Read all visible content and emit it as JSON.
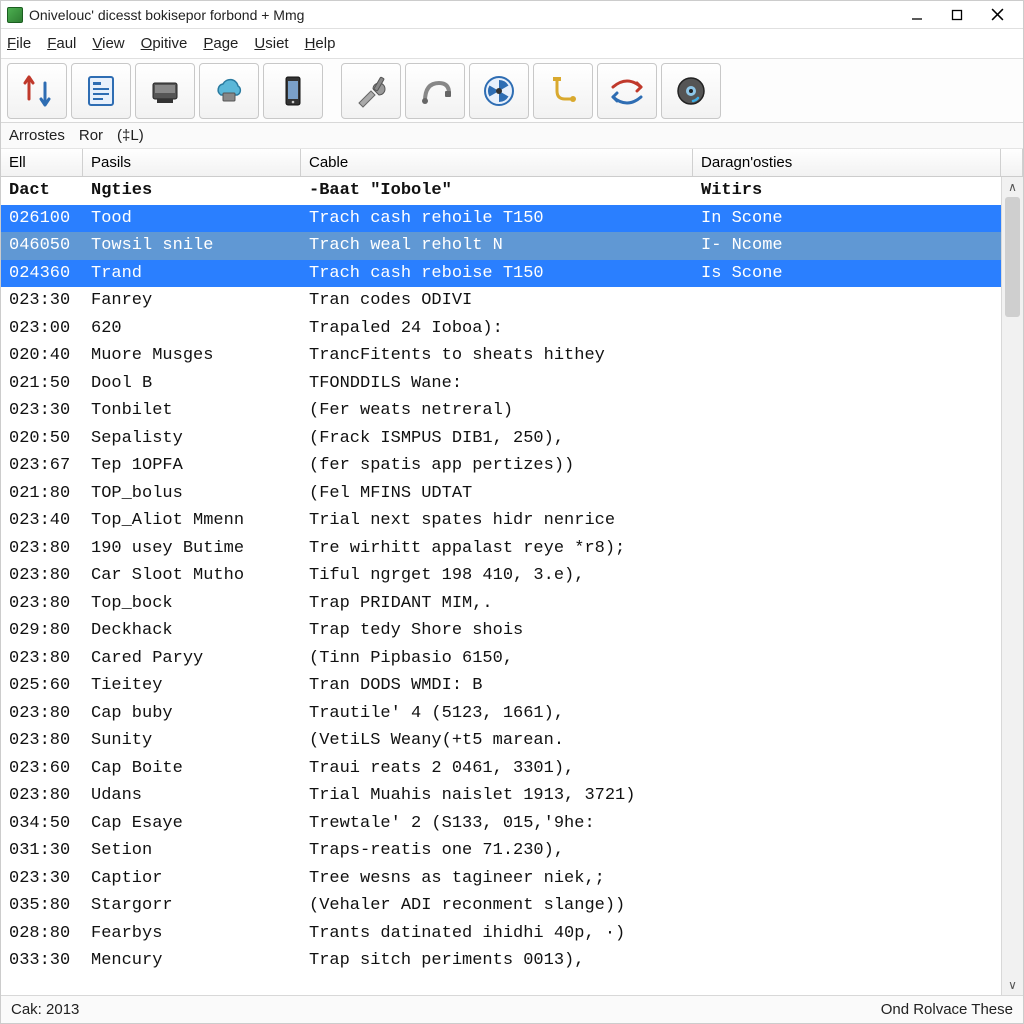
{
  "window": {
    "title": "Onivelouc' dicesst bokisepor forbond + Mmg"
  },
  "menu": {
    "items": [
      {
        "label_pre": "",
        "ul": "F",
        "label_post": "ile"
      },
      {
        "label_pre": "",
        "ul": "F",
        "label_post": "aul"
      },
      {
        "label_pre": "",
        "ul": "V",
        "label_post": "iew"
      },
      {
        "label_pre": "",
        "ul": "O",
        "label_post": "pitive"
      },
      {
        "label_pre": "",
        "ul": "P",
        "label_post": "age"
      },
      {
        "label_pre": "",
        "ul": "U",
        "label_post": "siet"
      },
      {
        "label_pre": "",
        "ul": "H",
        "label_post": "elp"
      }
    ]
  },
  "subbar": {
    "a": "Arrostes",
    "b": "Ror",
    "c": "(‡L)"
  },
  "headers": {
    "a": "Ell",
    "b": "Pasils",
    "c": "Cable",
    "d": "Daragn'osties"
  },
  "rows": [
    {
      "state": "header",
      "a": "Dact",
      "b": "Ngties",
      "c": "-Baat \"Iobole\"",
      "d": "Witirs"
    },
    {
      "state": "sel",
      "a": "026100",
      "b": "Tood",
      "c": "Trach cash rehoile T150",
      "d": "In Scone"
    },
    {
      "state": "seldim",
      "a": "046050",
      "b": "Towsil snile",
      "c": "Trach weal reholt N",
      "d": "I- Ncome"
    },
    {
      "state": "sel",
      "a": "024360",
      "b": "Trand",
      "c": "Trach cash reboise T150",
      "d": "Is Scone"
    },
    {
      "state": "",
      "a": "023:30",
      "b": "Fanrey",
      "c": "Tran codes ODIVI",
      "d": ""
    },
    {
      "state": "",
      "a": "023:00",
      "b": "620",
      "c": "Trapaled 24 Ioboa):",
      "d": ""
    },
    {
      "state": "",
      "a": "020:40",
      "b": "Muore Musges",
      "c": "TrancFitents to sheats hithey",
      "d": ""
    },
    {
      "state": "",
      "a": "021:50",
      "b": "Dool B",
      "c": "TFONDDILS Wane:",
      "d": ""
    },
    {
      "state": "",
      "a": "023:30",
      "b": "Tonbilet",
      "c": "(Fer weats netreral)",
      "d": ""
    },
    {
      "state": "",
      "a": "020:50",
      "b": "Sepalisty",
      "c": "(Frack ISMPUS DIB1, 250),",
      "d": ""
    },
    {
      "state": "",
      "a": "023:67",
      "b": "Tep 1OPFA",
      "c": "(fer spatis app pertizes))",
      "d": ""
    },
    {
      "state": "",
      "a": "021:80",
      "b": "TOP_bolus",
      "c": "(Fel MFINS UDTAT",
      "d": ""
    },
    {
      "state": "",
      "a": "023:40",
      "b": "Top_Aliot Mmenn",
      "c": "Trial next spates hidr nenrice",
      "d": ""
    },
    {
      "state": "",
      "a": "023:80",
      "b": "190 usey Butime",
      "c": "Tre wirhitt appalast reye *r8);",
      "d": ""
    },
    {
      "state": "",
      "a": "023:80",
      "b": "Car Sloot Mutho",
      "c": "Tiful ngrget 198 410, 3.e),",
      "d": ""
    },
    {
      "state": "",
      "a": "023:80",
      "b": "Top_bock",
      "c": "Trap PRIDANT MIM,.",
      "d": ""
    },
    {
      "state": "",
      "a": "029:80",
      "b": "Deckhack",
      "c": "Trap tedy Shore shois",
      "d": ""
    },
    {
      "state": "",
      "a": "023:80",
      "b": "Cared Paryy",
      "c": "(Tinn Pipbasio 6150,",
      "d": ""
    },
    {
      "state": "",
      "a": "025:60",
      "b": "Tieitey",
      "c": "Tran DODS WMDI: B",
      "d": ""
    },
    {
      "state": "",
      "a": "023:80",
      "b": "Cap buby",
      "c": "Trautile' 4 (5123, 1661),",
      "d": ""
    },
    {
      "state": "",
      "a": "023:80",
      "b": "Sunity",
      "c": "(VetiLS Weany(+t5 marean.",
      "d": ""
    },
    {
      "state": "",
      "a": "023:60",
      "b": "Cap Boite",
      "c": "Traui reats 2 0461, 3301),",
      "d": ""
    },
    {
      "state": "",
      "a": "023:80",
      "b": "Udans",
      "c": "Trial Muahis naislet 1913, 3721)",
      "d": ""
    },
    {
      "state": "",
      "a": "034:50",
      "b": "Cap Esaye",
      "c": "Trewtale' 2 (S133, 015,'9he:",
      "d": ""
    },
    {
      "state": "",
      "a": "031:30",
      "b": "Setion",
      "c": "Traps-reatis one 71.230),",
      "d": ""
    },
    {
      "state": "",
      "a": "023:30",
      "b": "Captior",
      "c": "Tree wesns as tagineer niek,;",
      "d": ""
    },
    {
      "state": "",
      "a": "035:80",
      "b": "Stargorr",
      "c": "(Vehaler ADI reconment slange))",
      "d": ""
    },
    {
      "state": "",
      "a": "028:80",
      "b": "Fearbys",
      "c": "Trants datinated ihidhi 40p, ·)",
      "d": ""
    },
    {
      "state": "",
      "a": "033:30",
      "b": "Mencury",
      "c": "Trap sitch periments 0013),",
      "d": ""
    }
  ],
  "status": {
    "left": "Cak: 2013",
    "right": "Ond Rolvace These"
  }
}
